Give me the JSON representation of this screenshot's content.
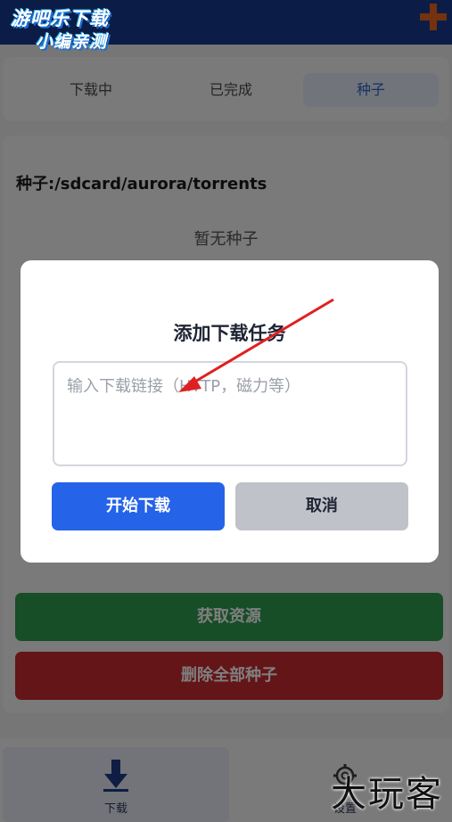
{
  "watermark": {
    "line1": "游吧乐下载",
    "line2": "小编亲测",
    "brand": "大玩客"
  },
  "tabs": [
    {
      "label": "下载中"
    },
    {
      "label": "已完成"
    },
    {
      "label": "种子"
    }
  ],
  "main": {
    "path_label": "种子:/sdcard/aurora/torrents",
    "empty_text": "暂无种子",
    "fetch_button": "获取资源",
    "delete_button": "删除全部种子"
  },
  "dialog": {
    "title": "添加下载任务",
    "input_placeholder": "输入下载链接（HTTP，磁力等）",
    "input_value": "",
    "start_button": "开始下载",
    "cancel_button": "取消"
  },
  "nav": {
    "items": [
      {
        "label": "下载",
        "icon": "download-arrow-icon"
      },
      {
        "label": "设置",
        "icon": "gear-icon"
      }
    ]
  },
  "colors": {
    "header": "#163b8d",
    "accent": "#2563e8",
    "plus_icon": "#e8651c",
    "fetch_green": "#2e9b4e",
    "delete_red": "#c82a2e",
    "annotation_arrow": "#e02020"
  }
}
